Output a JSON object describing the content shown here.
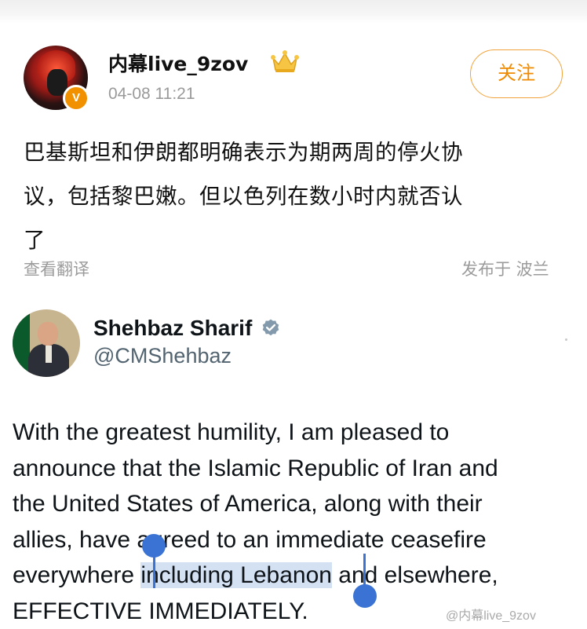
{
  "post": {
    "author": "内幕live_9zov",
    "verified_badge": "V",
    "timestamp": "04-08 11:21",
    "follow_label": "关注",
    "text_lines": [
      "巴基斯坦和伊朗都明确表示为期两周的停火协",
      "议，包括黎巴嫩。但以色列在数小时内就否认",
      "了"
    ],
    "translate_label": "查看翻译",
    "location_label": "发布于 波兰",
    "accent_color": "#f08a00"
  },
  "tweet": {
    "name": "Shehbaz Sharif",
    "handle": "@CMShehbaz",
    "line1": "With the greatest humility, I am pleased to",
    "line2": "announce that the Islamic Republic of Iran and",
    "line3": "the United States of America, along with their",
    "line4": "allies, have agreed to an immediate ceasefire",
    "line5_before": "everywhere ",
    "line5_selected": "including Lebanon",
    "line5_after": " and elsewhere,",
    "line6": "EFFECTIVE IMMEDIATELY.",
    "selection_color": "#3a73d4"
  },
  "watermark": "@内幕live_9zov"
}
